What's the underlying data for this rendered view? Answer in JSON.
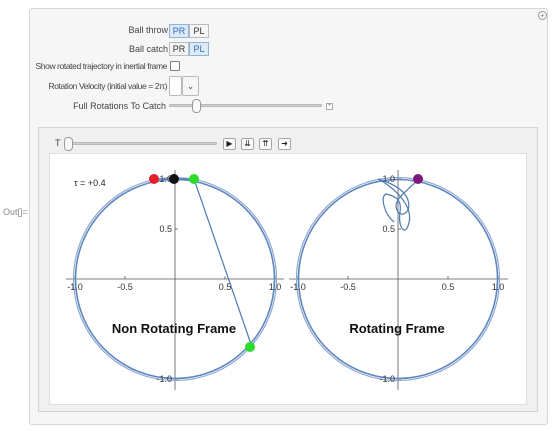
{
  "cell": {
    "out_label": "Out[]="
  },
  "controls": {
    "ball_throw": {
      "label": "Ball throw",
      "options": [
        "PR",
        "PL"
      ],
      "selected": "PR"
    },
    "ball_catch": {
      "label": "Ball catch",
      "options": [
        "PR",
        "PL"
      ],
      "selected": "PL"
    },
    "show_trajectory": {
      "label": "Show rotated trajectory in inertial frame",
      "checked": false
    },
    "rotation_velocity": {
      "label": "Rotation Velocity (initial value = 2π)",
      "value": ""
    },
    "full_rotations": {
      "label": "Full Rotations To Catch",
      "slider_fraction": 0.2
    }
  },
  "animator": {
    "label": "T",
    "slider_fraction": 0.0
  },
  "plot": {
    "tau_label": "τ = +0.4",
    "left": {
      "title": "Non Rotating Frame",
      "x_ticks": [
        "-1.0",
        "-0.5",
        "0.5",
        "1.0"
      ],
      "y_ticks": [
        "1.0",
        "0.5",
        "-1.0"
      ],
      "colors": {
        "circle": "#6b8fc4",
        "trajectory": "#4e7bb0",
        "red_dot": "#e2202a",
        "black_dot": "#111111",
        "green_dot": "#2bdc2b"
      }
    },
    "right": {
      "title": "Rotating Frame",
      "x_ticks": [
        "-1.0",
        "-0.5",
        "0.5",
        "1.0"
      ],
      "y_ticks": [
        "1.0",
        "0.5",
        "-1.0"
      ],
      "colors": {
        "circle": "#6b8fc4",
        "trajectory": "#4e7bb0",
        "purple_dot": "#7a1a7e"
      }
    }
  }
}
